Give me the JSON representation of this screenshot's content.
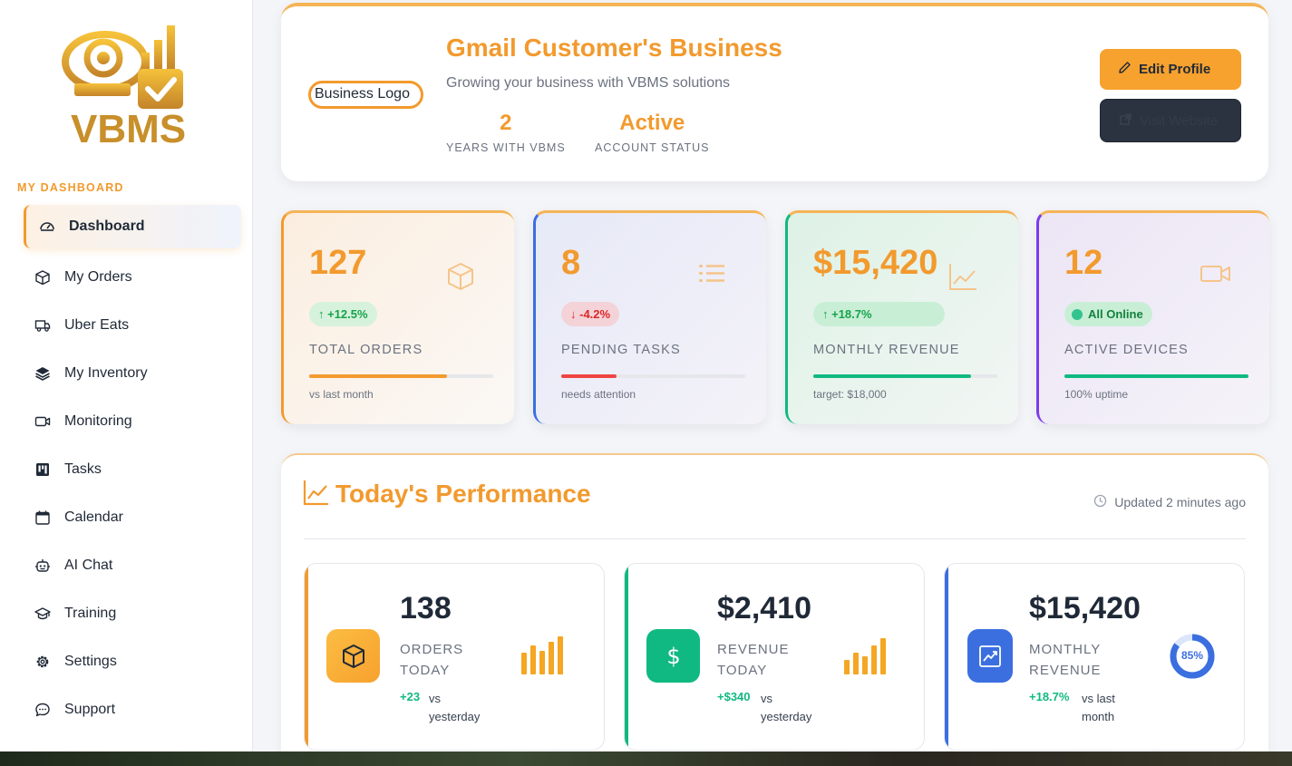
{
  "sidebar": {
    "logo_text": "VBMS",
    "section_label": "MY DASHBOARD",
    "items": [
      {
        "label": "Dashboard",
        "icon": "gauge-icon"
      },
      {
        "label": "My Orders",
        "icon": "box-icon"
      },
      {
        "label": "Uber Eats",
        "icon": "truck-icon"
      },
      {
        "label": "My Inventory",
        "icon": "layers-icon"
      },
      {
        "label": "Monitoring",
        "icon": "video-icon"
      },
      {
        "label": "Tasks",
        "icon": "kanban-icon"
      },
      {
        "label": "Calendar",
        "icon": "calendar-icon"
      },
      {
        "label": "AI Chat",
        "icon": "robot-icon"
      },
      {
        "label": "Training",
        "icon": "graduation-cap-icon"
      },
      {
        "label": "Settings",
        "icon": "gear-icon"
      },
      {
        "label": "Support",
        "icon": "chat-bubble-icon"
      }
    ]
  },
  "profile": {
    "logo_alt": "Business Logo",
    "title": "Gmail Customer's Business",
    "subtitle": "Growing your business with VBMS solutions",
    "years_value": "2",
    "years_label": "YEARS WITH VBMS",
    "status_value": "Active",
    "status_label": "ACCOUNT STATUS",
    "edit_label": "Edit Profile",
    "dark_label": "Visit Website"
  },
  "stats": [
    {
      "value": "127",
      "badge": "↑ +12.5%",
      "label": "TOTAL ORDERS",
      "note": "vs last month",
      "progress": 0.75,
      "accent": "#f29a2e",
      "icon": "box-icon"
    },
    {
      "value": "8",
      "badge": "↓ -4.2%",
      "label": "PENDING TASKS",
      "note": "needs attention",
      "progress": 0.3,
      "accent": "#3b6fe0",
      "icon": "list-icon"
    },
    {
      "value": "$15,420",
      "badge": "↑ +18.7%",
      "label": "MONTHLY REVENUE",
      "note": "target: $18,000",
      "progress": 0.857,
      "accent": "#10b981",
      "icon": "line-chart-icon"
    },
    {
      "value": "12",
      "badge": "All Online",
      "label": "ACTIVE DEVICES",
      "note": "100% uptime",
      "progress": 1.0,
      "accent": "#7c3aed",
      "icon": "video-icon"
    }
  ],
  "performance": {
    "title": "Today's Performance",
    "updated": "Updated 2 minutes ago",
    "cards": [
      {
        "value": "138",
        "label1": "ORDERS",
        "label2": "TODAY",
        "change": "+23",
        "change_label1": "vs",
        "change_label2": "yesterday",
        "accent": "#f29a2e",
        "icon": "box-icon"
      },
      {
        "value": "$2,410",
        "label1": "REVENUE",
        "label2": "TODAY",
        "change": "+$340",
        "change_label1": "vs",
        "change_label2": "yesterday",
        "accent": "#10b981",
        "icon": "dollar-icon"
      },
      {
        "value": "$15,420",
        "label1": "MONTHLY",
        "label2": "REVENUE",
        "change": "+18.7%",
        "change_label1": "vs last",
        "change_label2": "month",
        "accent": "#3b6fe0",
        "icon": "trend-up-icon",
        "ring": "85%",
        "ring_value": 0.85
      }
    ]
  }
}
